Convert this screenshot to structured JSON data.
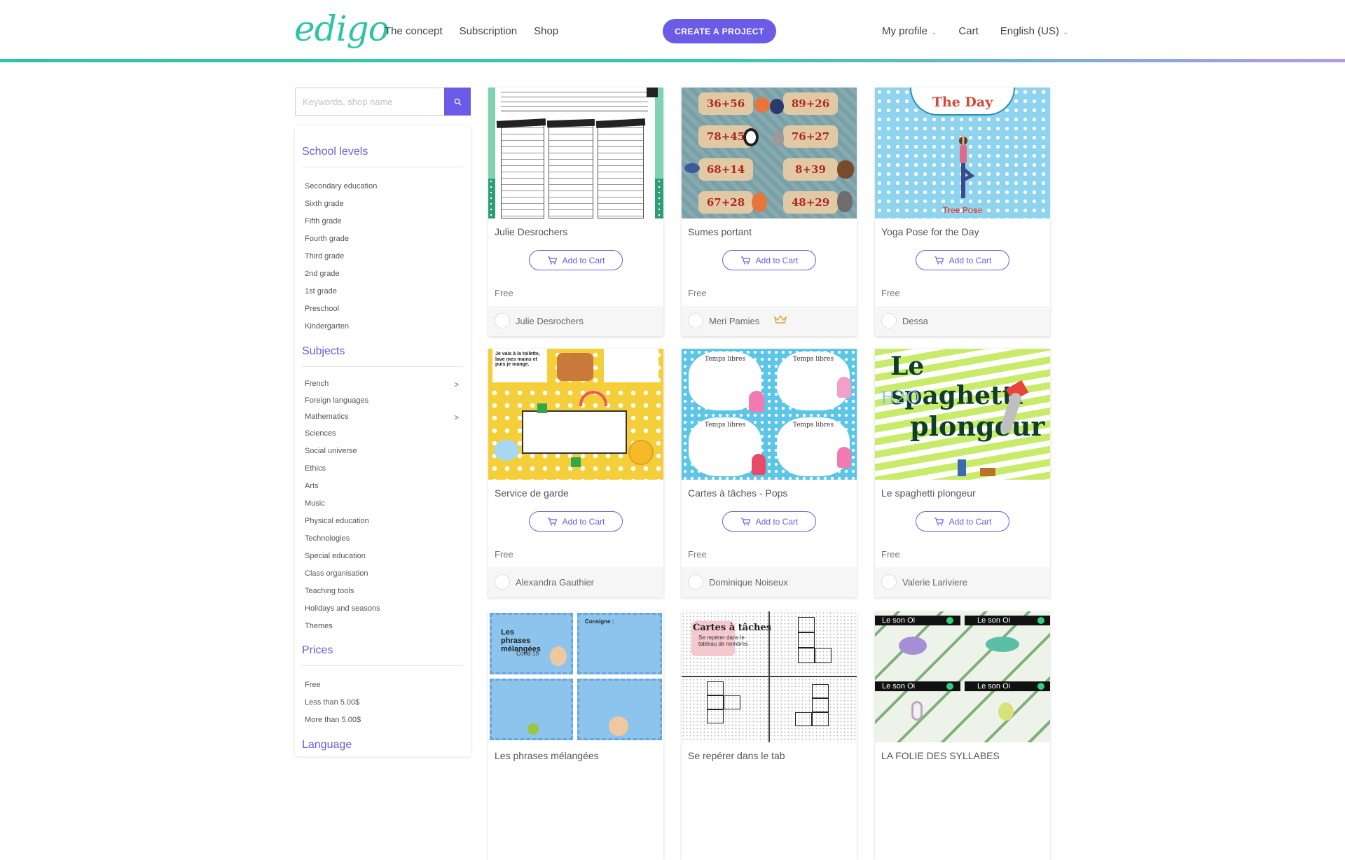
{
  "header": {
    "logo": "edigo",
    "nav": [
      "The concept",
      "Subscription",
      "Shop"
    ],
    "create_button": "CREATE A PROJECT",
    "profile": "My profile",
    "cart": "Cart",
    "language": "English (US)"
  },
  "search": {
    "placeholder": "Keywords, shop name",
    "icon": "search-icon"
  },
  "sidebar": {
    "school_levels": {
      "title": "School levels",
      "items": [
        "Secondary education",
        "Sixth grade",
        "Fifth grade",
        "Fourth grade",
        "Third grade",
        "2nd grade",
        "1st grade",
        "Preschool",
        "Kindergarten"
      ]
    },
    "subjects": {
      "title": "Subjects",
      "items": [
        "French",
        "Foreign languages",
        "Mathematics",
        "Sciences",
        "Social universe",
        "Ethics",
        "Arts",
        "Music",
        "Physical education",
        "Technologies",
        "Special education",
        "Class organisation",
        "Teaching tools",
        "Holidays and seasons",
        "Themes"
      ],
      "arrow": ">"
    },
    "prices": {
      "title": "Prices",
      "items": [
        "Free",
        "Less than 5.00$",
        "More than 5.00$"
      ]
    },
    "language": {
      "title": "Language"
    }
  },
  "products": [
    {
      "title": "Julie Desrochers",
      "cart": "Add to Cart",
      "price": "Free",
      "author": "Julie Desrochers"
    },
    {
      "title": "Sumes portant",
      "cart": "Add to Cart",
      "price": "Free",
      "author": "Meri Pamies"
    },
    {
      "title": "Yoga Pose for the Day",
      "cart": "Add to Cart",
      "price": "Free",
      "author": "Dessa"
    },
    {
      "title": "Service de garde",
      "cart": "Add to Cart",
      "price": "Free",
      "author": "Alexandra Gauthier"
    },
    {
      "title": "Cartes à tâches - Pops",
      "cart": "Add to Cart",
      "price": "Free",
      "author": "Dominique Noiseux"
    },
    {
      "title": "Le spaghetti plongeur",
      "cart": "Add to Cart",
      "price": "Free",
      "author": "Valerie Lariviere"
    },
    {
      "title": "Les phrases mélangées"
    },
    {
      "title": "Se repérer dans le tab"
    },
    {
      "title": "LA FOLIE DES SYLLABES"
    }
  ],
  "thumbs": {
    "math_cards": [
      "36+56",
      "89+26",
      "78+45",
      "76+27",
      "68+14",
      "8+39",
      "67+28",
      "48+29"
    ],
    "yoga_heading": "The Day",
    "yoga_caption": "Tree Pose",
    "spaghetti_line1": "Le spaghetti",
    "spaghetti_line2": "plongeur",
    "spaghetti_h2o": "H2O",
    "phrases_title": "Les phrases mélangées",
    "phrases_sub": "Covid-19",
    "phrases_consigne": "Consigne :",
    "cartes_title": "Cartes à tâches",
    "cartes_sub": "Se repérer dans le tableau de nombres",
    "syllabes_label": "Le son Oi",
    "garde_text": "Je vais à la toilette, lave mes mains et puis je mange.",
    "pops_label": "Temps libres"
  },
  "colors": {
    "accent": "#6b5ce7",
    "teal": "#2ec4a9"
  }
}
